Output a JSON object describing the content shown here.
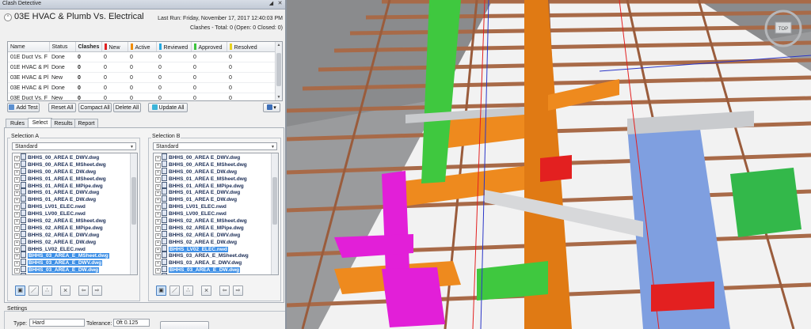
{
  "panel": {
    "title": "Clash Detective",
    "window_controls": [
      "◢",
      "✕"
    ],
    "collapse_glyph": "^",
    "test_name": "03E HVAC & Plumb Vs. Electrical",
    "last_run": "Last Run:  Friday, November 17, 2017 12:40:03 PM",
    "clashes_summary": "Clashes - Total:  0  (Open:  0  Closed:  0)"
  },
  "grid": {
    "columns": [
      "Name",
      "Status",
      "Clashes",
      "New",
      "Active",
      "Reviewed",
      "Approved",
      "Resolved"
    ],
    "column_colors": {
      "New": "#e02020",
      "Active": "#f08c00",
      "Reviewed": "#22a8e0",
      "Approved": "#3cc43c",
      "Resolved": "#e8d21e"
    },
    "rows": [
      {
        "name": "01E Duct Vs. F",
        "status": "Done",
        "clashes": "0",
        "new": "0",
        "active": "0",
        "reviewed": "0",
        "approved": "0",
        "resolved": "0"
      },
      {
        "name": "01E HVAC & Pl",
        "status": "Done",
        "clashes": "0",
        "new": "0",
        "active": "0",
        "reviewed": "0",
        "approved": "0",
        "resolved": "0"
      },
      {
        "name": "03E HVAC & Pl",
        "status": "New",
        "clashes": "0",
        "new": "0",
        "active": "0",
        "reviewed": "0",
        "approved": "0",
        "resolved": "0"
      },
      {
        "name": "03E HVAC & Pl",
        "status": "Done",
        "clashes": "0",
        "new": "0",
        "active": "0",
        "reviewed": "0",
        "approved": "0",
        "resolved": "0"
      },
      {
        "name": "03E Duct Vs. F",
        "status": "New",
        "clashes": "0",
        "new": "0",
        "active": "0",
        "reviewed": "0",
        "approved": "0",
        "resolved": "0"
      }
    ]
  },
  "toolbar": {
    "add_test": "Add Test",
    "reset_all": "Reset All",
    "compact_all": "Compact All",
    "delete_all": "Delete All",
    "update_all": "Update All"
  },
  "tabs": [
    "Rules",
    "Select",
    "Results",
    "Report"
  ],
  "active_tab": "Select",
  "selection_a": {
    "label": "Selection A",
    "dropdown": "Standard",
    "items": [
      {
        "name": "BHHS_00_AREA E_DWV.dwg",
        "selected": false
      },
      {
        "name": "BHHS_00_AREA E_MSheet.dwg",
        "selected": false
      },
      {
        "name": "BHHS_00_AREA E_DW.dwg",
        "selected": false
      },
      {
        "name": "BHHS_01_AREA E_MSheet.dwg",
        "selected": false
      },
      {
        "name": "BHHS_01_AREA E_MPipe.dwg",
        "selected": false
      },
      {
        "name": "BHHS_01_AREA E_DWV.dwg",
        "selected": false
      },
      {
        "name": "BHHS_01_AREA E_DW.dwg",
        "selected": false
      },
      {
        "name": "BHHS_LV01_ELEC.nwd",
        "selected": false
      },
      {
        "name": "BHHS_LV00_ELEC.nwd",
        "selected": false
      },
      {
        "name": "BHHS_02_AREA E_MSheet.dwg",
        "selected": false
      },
      {
        "name": "BHHS_02_AREA E_MPipe.dwg",
        "selected": false
      },
      {
        "name": "BHHS_02_AREA E_DWV.dwg",
        "selected": false
      },
      {
        "name": "BHHS_02_AREA E_DW.dwg",
        "selected": false
      },
      {
        "name": "BHHS_LV02_ELEC.nwd",
        "selected": false
      },
      {
        "name": "BHHS_03_AREA_E_MSheet.dwg",
        "selected": true
      },
      {
        "name": "BHHS_03_AREA_E_DWV.dwg",
        "selected": true
      },
      {
        "name": "BHHS_03_AREA_E_DW.dwg",
        "selected": true
      },
      {
        "name": "BHHS_03_AREA E_MPipe.dwg",
        "selected": true
      }
    ]
  },
  "selection_b": {
    "label": "Selection B",
    "dropdown": "Standard",
    "items": [
      {
        "name": "BHHS_00_AREA E_DWV.dwg",
        "selected": false
      },
      {
        "name": "BHHS_00_AREA E_MSheet.dwg",
        "selected": false
      },
      {
        "name": "BHHS_00_AREA E_DW.dwg",
        "selected": false
      },
      {
        "name": "BHHS_01_AREA E_MSheet.dwg",
        "selected": false
      },
      {
        "name": "BHHS_01_AREA E_MPipe.dwg",
        "selected": false
      },
      {
        "name": "BHHS_01_AREA E_DWV.dwg",
        "selected": false
      },
      {
        "name": "BHHS_01_AREA E_DW.dwg",
        "selected": false
      },
      {
        "name": "BHHS_LV01_ELEC.nwd",
        "selected": false
      },
      {
        "name": "BHHS_LV00_ELEC.nwd",
        "selected": false
      },
      {
        "name": "BHHS_02_AREA E_MSheet.dwg",
        "selected": false
      },
      {
        "name": "BHHS_02_AREA E_MPipe.dwg",
        "selected": false
      },
      {
        "name": "BHHS_02_AREA E_DWV.dwg",
        "selected": false
      },
      {
        "name": "BHHS_02_AREA E_DW.dwg",
        "selected": false
      },
      {
        "name": "BHHS_LV02_ELEC.nwd",
        "selected": true
      },
      {
        "name": "BHHS_03_AREA_E_MSheet.dwg",
        "selected": false
      },
      {
        "name": "BHHS_03_AREA_E_DWV.dwg",
        "selected": false
      },
      {
        "name": "BHHS_03_AREA_E_DW.dwg",
        "selected": true
      },
      {
        "name": "BHHS_03_AREA E_DWV.dwg",
        "selected": false
      }
    ]
  },
  "settings": {
    "label": "Settings",
    "type_label": "Type:",
    "type_value": "Hard",
    "tolerance_label": "Tolerance:",
    "tolerance_value": "0ft 0.125"
  },
  "navcube": {
    "label": "TOP"
  },
  "colors": {
    "accent": "#3b8ee6",
    "panel_bg": "#f0f0f0"
  }
}
